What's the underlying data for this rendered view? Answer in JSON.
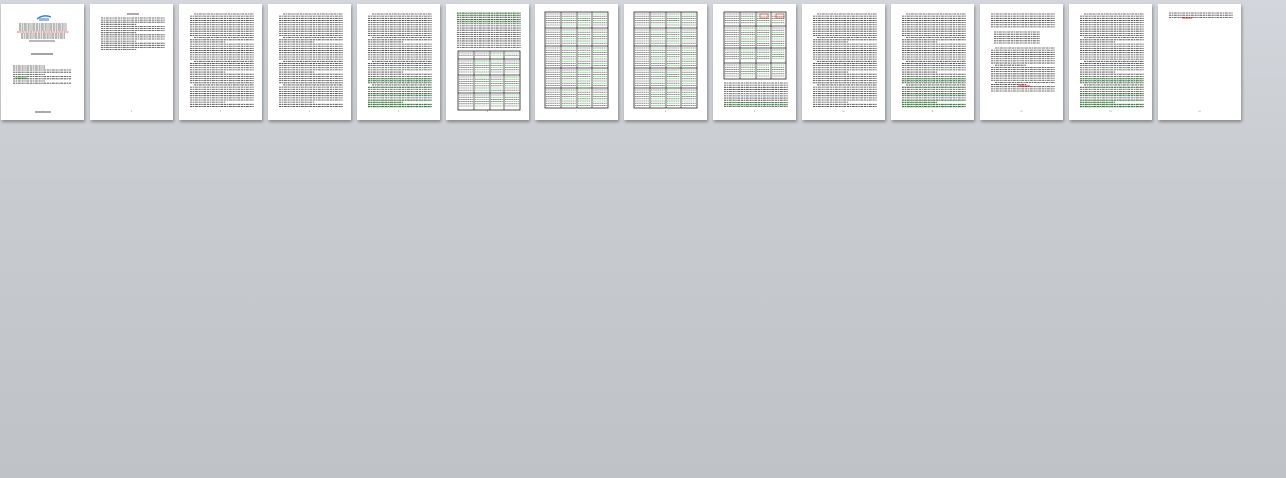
{
  "view": {
    "mode": "multi-page thumbnails",
    "background_color": "#c5c8cd"
  },
  "pages": [
    {
      "number": "1",
      "kind": "title",
      "logo_color": "#3a7fd0"
    },
    {
      "number": "2",
      "kind": "contents"
    },
    {
      "number": "3",
      "kind": "text"
    },
    {
      "number": "4",
      "kind": "text"
    },
    {
      "number": "5",
      "kind": "text",
      "highlight": "green"
    },
    {
      "number": "6",
      "kind": "text-with-table",
      "highlight": "green"
    },
    {
      "number": "7",
      "kind": "table",
      "highlight": "green"
    },
    {
      "number": "8",
      "kind": "table",
      "highlight": "green"
    },
    {
      "number": "9",
      "kind": "table-with-text",
      "highlight": "green"
    },
    {
      "number": "10",
      "kind": "text"
    },
    {
      "number": "11",
      "kind": "text",
      "highlight": "green"
    },
    {
      "number": "12",
      "kind": "text-with-lists"
    },
    {
      "number": "13",
      "kind": "text",
      "highlight": "green"
    },
    {
      "number": "14",
      "kind": "short-text"
    },
    {
      "number": "15",
      "kind": "short-text"
    }
  ],
  "colors": {
    "text": "#444444",
    "highlight_green": "#35b83a",
    "mark_red": "#d22a2a",
    "table_border": "#222222"
  }
}
